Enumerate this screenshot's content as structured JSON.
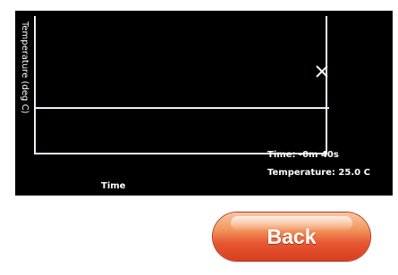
{
  "plot": {
    "y_axis_label": "Temperature (deg C)",
    "x_axis_label": "Time"
  },
  "readout": {
    "time": "Time: -0m 40s",
    "temperature": "Temperature: 25.0 C"
  },
  "buttons": {
    "back_label": "Back"
  },
  "colors": {
    "plot_background": "#000000",
    "plot_lines": "#f4ecf6",
    "button_accent": "#e85a33"
  },
  "icons": {
    "cursor": "x-marker-icon"
  }
}
